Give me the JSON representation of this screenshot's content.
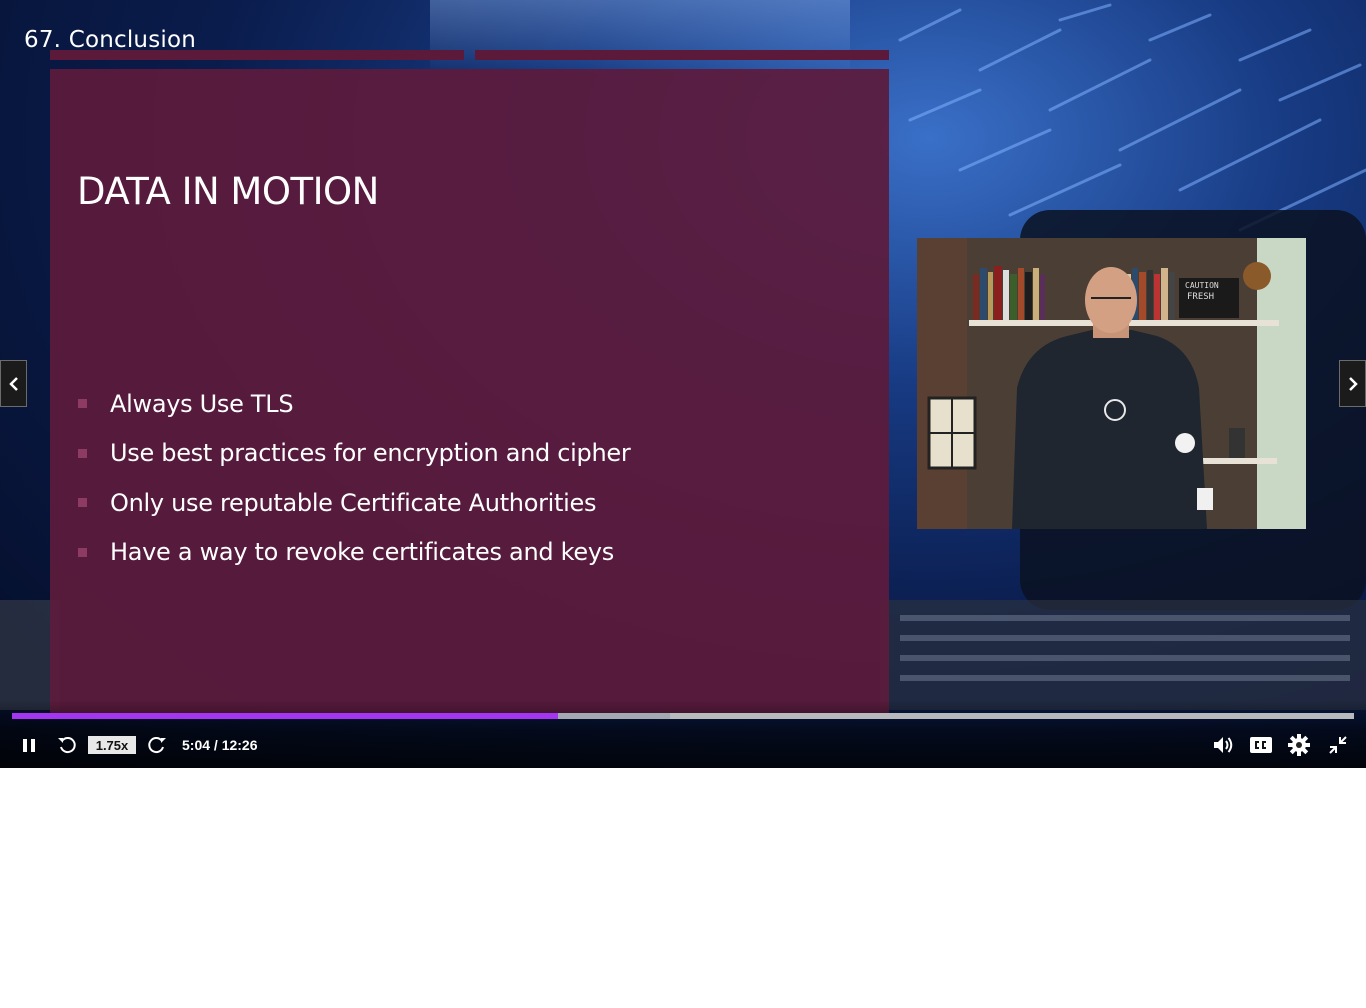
{
  "player": {
    "title": "67. Conclusion",
    "progress_percent": 40.7,
    "buffered_percent": 49,
    "speed_label": "1.75x",
    "time_display": "5:04 / 12:26"
  },
  "slide": {
    "heading": "DATA IN MOTION",
    "bullets": [
      "Always Use TLS",
      "Use best practices for encryption and cipher",
      "Only use reputable Certificate Authorities",
      "Have a way to revoke certificates and keys"
    ]
  },
  "webcam": {
    "sign_lines": [
      "CAUTION",
      "FRESH"
    ]
  },
  "icons": {
    "pause": "pause-icon",
    "rewind": "rewind-5-icon",
    "forward": "forward-5-icon",
    "volume": "volume-icon",
    "captions": "closed-captions-icon",
    "settings": "gear-icon",
    "fullscreen_exit": "exit-fullscreen-icon",
    "prev": "chevron-left-icon",
    "next": "chevron-right-icon"
  },
  "colors": {
    "slide_bg": "#5c1b3c",
    "progress_played": "#a435f0",
    "bullet": "#8d3b63"
  }
}
